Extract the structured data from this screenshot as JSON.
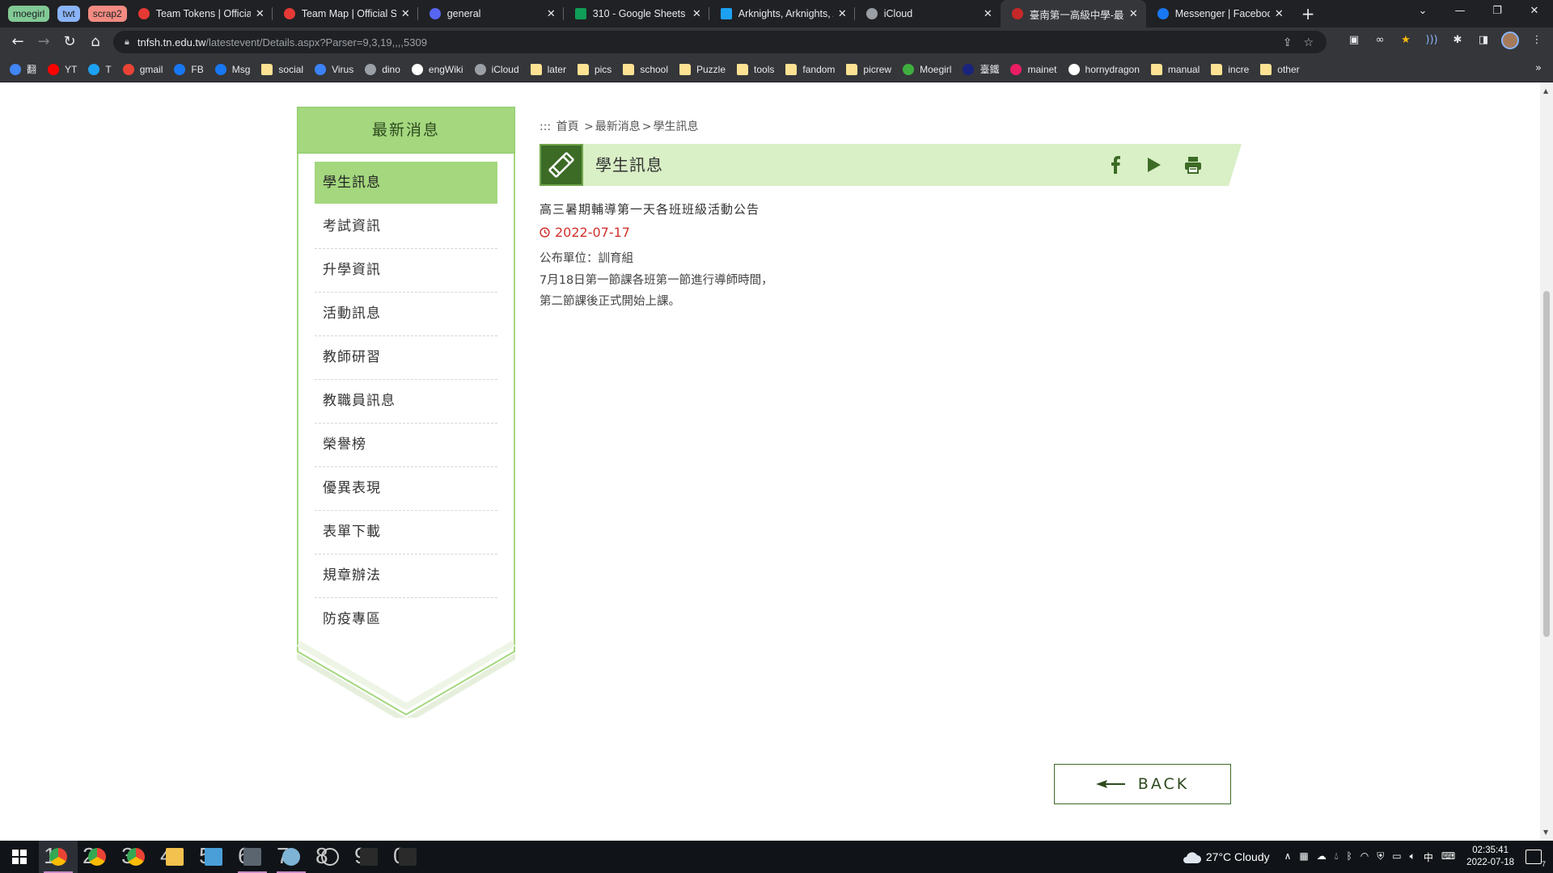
{
  "browser": {
    "tab_groups": [
      {
        "label": "moegirl",
        "color": "#81c995"
      },
      {
        "label": "twt",
        "color": "#8ab4f8"
      },
      {
        "label": "scrap2",
        "color": "#f28b82"
      }
    ],
    "tabs": [
      {
        "title": "Team Tokens | Official Site",
        "favicon_color": "#e53935"
      },
      {
        "title": "Team Map | Official Site",
        "favicon_color": "#e53935"
      },
      {
        "title": "general",
        "favicon_color": "#5865f2"
      },
      {
        "title": "310 - Google Sheets",
        "favicon_color": "#0f9d58"
      },
      {
        "title": "Arknights, Arknights, A",
        "favicon_color": "#1da1f2"
      },
      {
        "title": "iCloud",
        "favicon_color": "#9aa0a6"
      },
      {
        "title": "臺南第一高級中學-最新",
        "favicon_color": "#c62828"
      },
      {
        "title": "Messenger | Facebook",
        "favicon_color": "#1877f2"
      }
    ],
    "url_host": "tnfsh.tn.edu.tw",
    "url_path": "/latestevent/Details.aspx?Parser=9,3,19,,,,5309",
    "bookmarks": [
      {
        "label": "翻",
        "icon": "translate-icon",
        "color": "#4285f4"
      },
      {
        "label": "YT",
        "icon": "youtube-icon",
        "color": "#ff0000"
      },
      {
        "label": "T",
        "icon": "twitter-icon",
        "color": "#1da1f2"
      },
      {
        "label": "gmail",
        "icon": "gmail-icon",
        "color": "#ea4335"
      },
      {
        "label": "FB",
        "icon": "facebook-icon",
        "color": "#1877f2"
      },
      {
        "label": "Msg",
        "icon": "facebook-icon",
        "color": "#1877f2"
      },
      {
        "label": "social",
        "icon": "folder-icon",
        "color": "#fde293"
      },
      {
        "label": "Virus",
        "icon": "vscode-icon",
        "color": "#3b82f6"
      },
      {
        "label": "dino",
        "icon": "globe-icon",
        "color": "#9aa0a6"
      },
      {
        "label": "engWiki",
        "icon": "wikipedia-icon",
        "color": "#ffffff"
      },
      {
        "label": "iCloud",
        "icon": "apple-icon",
        "color": "#9aa0a6"
      },
      {
        "label": "later",
        "icon": "folder-icon",
        "color": "#fde293"
      },
      {
        "label": "pics",
        "icon": "folder-icon",
        "color": "#fde293"
      },
      {
        "label": "school",
        "icon": "folder-icon",
        "color": "#fde293"
      },
      {
        "label": "Puzzle",
        "icon": "folder-icon",
        "color": "#fde293"
      },
      {
        "label": "tools",
        "icon": "folder-icon",
        "color": "#fde293"
      },
      {
        "label": "fandom",
        "icon": "folder-icon",
        "color": "#fde293"
      },
      {
        "label": "picrew",
        "icon": "folder-icon",
        "color": "#fde293"
      },
      {
        "label": "Moegirl",
        "icon": "moegirl-icon",
        "color": "#3fae3f"
      },
      {
        "label": "臺鐵",
        "icon": "tra-icon",
        "color": "#1a237e"
      },
      {
        "label": "mainet",
        "icon": "mainet-icon",
        "color": "#e91e63"
      },
      {
        "label": "hornydragon",
        "icon": "dragon-icon",
        "color": "#ffffff"
      },
      {
        "label": "manual",
        "icon": "folder-icon",
        "color": "#fde293"
      },
      {
        "label": "incre",
        "icon": "folder-icon",
        "color": "#fde293"
      },
      {
        "label": "other",
        "icon": "folder-icon",
        "color": "#fde293"
      }
    ]
  },
  "sidebar": {
    "heading": "最新消息",
    "items": [
      {
        "label": "學生訊息",
        "active": true
      },
      {
        "label": "考試資訊"
      },
      {
        "label": "升學資訊"
      },
      {
        "label": "活動訊息"
      },
      {
        "label": "教師研習"
      },
      {
        "label": "教職員訊息"
      },
      {
        "label": "榮譽榜"
      },
      {
        "label": "優異表現"
      },
      {
        "label": "表單下載"
      },
      {
        "label": "規章辦法"
      },
      {
        "label": "防疫專區"
      }
    ]
  },
  "breadcrumb": {
    "prefix": ":::",
    "home": "首頁",
    "sep": ">",
    "level1": "最新消息",
    "level2": "學生訊息"
  },
  "section_title": "學生訊息",
  "article": {
    "title": "高三暑期輔導第一天各班班級活動公告",
    "date": "2022-07-17",
    "unit": "公布單位：訓育組",
    "body_line1": "7月18日第一節課各班第一節進行導師時間，",
    "body_line2": "第二節課後正式開始上課。"
  },
  "back_label": "BACK",
  "colors": {
    "accent_green": "#a4d77e",
    "dark_green": "#3c6b26",
    "title_band": "#d9efc6",
    "date_red": "#d0312d"
  },
  "taskbar": {
    "apps": [
      "1",
      "2",
      "3",
      "4",
      "5",
      "6",
      "7",
      "8",
      "9",
      "0"
    ],
    "weather": "27°C  Cloudy",
    "ime": "中",
    "time": "02:35:41",
    "date": "2022-07-18",
    "notifications": "7"
  }
}
